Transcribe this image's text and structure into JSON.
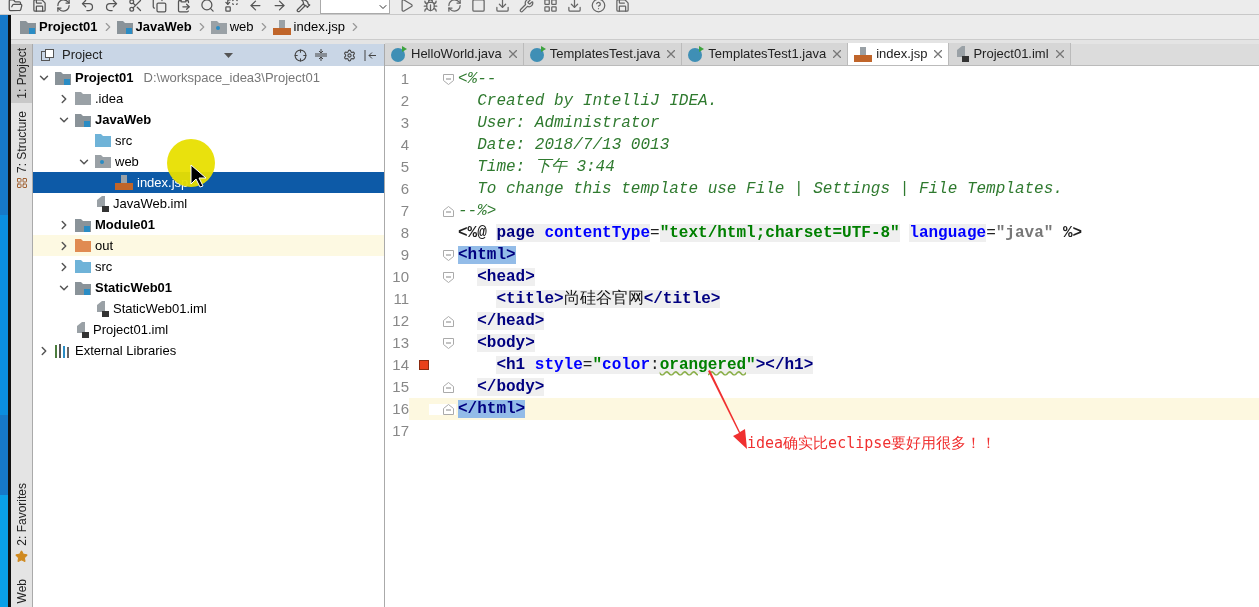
{
  "breadcrumb": [
    {
      "label": "Project01",
      "kind": "module"
    },
    {
      "label": "JavaWeb",
      "kind": "module"
    },
    {
      "label": "web",
      "kind": "web"
    },
    {
      "label": "index.jsp",
      "kind": "jsp"
    }
  ],
  "side_tabs": [
    {
      "label": "1: Project",
      "selected": true,
      "kind": "project"
    },
    {
      "label": "7: Structure",
      "selected": false,
      "kind": "structure"
    },
    {
      "label": "2: Favorites",
      "selected": false,
      "kind": "favorites"
    },
    {
      "label": "Web",
      "selected": false,
      "kind": "web"
    }
  ],
  "project_panel": {
    "title": "Project"
  },
  "tree": [
    {
      "label": "Project01",
      "path": "D:\\workspace_idea3\\Project01",
      "kind": "module",
      "expanded": true,
      "selected": false,
      "highlighted": false,
      "children": [
        {
          "label": ".idea",
          "kind": "folder",
          "expanded": false,
          "selected": false,
          "highlighted": false
        },
        {
          "label": "JavaWeb",
          "kind": "module",
          "expanded": true,
          "selected": false,
          "highlighted": false,
          "children": [
            {
              "label": "src",
              "kind": "source",
              "selected": false,
              "highlighted": false
            },
            {
              "label": "web",
              "kind": "web",
              "expanded": true,
              "selected": false,
              "highlighted": false,
              "children": [
                {
                  "label": "index.jsp",
                  "kind": "jsp",
                  "selected": true,
                  "highlighted": false
                }
              ]
            },
            {
              "label": "JavaWeb.iml",
              "kind": "iml",
              "selected": false,
              "highlighted": false
            }
          ]
        },
        {
          "label": "Module01",
          "kind": "module",
          "expanded": false,
          "selected": false,
          "highlighted": false
        },
        {
          "label": "out",
          "kind": "excluded",
          "expanded": false,
          "selected": false,
          "highlighted": true
        },
        {
          "label": "src",
          "kind": "source",
          "expanded": false,
          "selected": false,
          "highlighted": false
        },
        {
          "label": "StaticWeb01",
          "kind": "module",
          "expanded": true,
          "selected": false,
          "highlighted": false,
          "children": [
            {
              "label": "StaticWeb01.iml",
              "kind": "iml",
              "selected": false,
              "highlighted": false
            }
          ]
        },
        {
          "label": "Project01.iml",
          "kind": "iml",
          "selected": false,
          "highlighted": false
        }
      ]
    },
    {
      "label": "External Libraries",
      "kind": "libraries",
      "expanded": false,
      "selected": false,
      "highlighted": false
    }
  ],
  "editor_tabs": [
    {
      "label": "HelloWorld.java",
      "kind": "java",
      "selected": false
    },
    {
      "label": "TemplatesTest.java",
      "kind": "java",
      "selected": false
    },
    {
      "label": "TemplatesTest1.java",
      "kind": "java",
      "selected": false
    },
    {
      "label": "index.jsp",
      "kind": "jsp",
      "selected": true
    },
    {
      "label": "Project01.iml",
      "kind": "iml",
      "selected": false
    }
  ],
  "code_lines": [
    {
      "number": "1",
      "fold_open": true,
      "fold_close": false,
      "current": false,
      "marker": false,
      "tokens": [
        {
          "kind": "comment",
          "text": "<%--"
        }
      ]
    },
    {
      "number": "2",
      "fold_open": false,
      "fold_close": false,
      "current": false,
      "marker": false,
      "tokens": [
        {
          "kind": "comment",
          "text": "  Created by IntelliJ IDEA."
        }
      ]
    },
    {
      "number": "3",
      "fold_open": false,
      "fold_close": false,
      "current": false,
      "marker": false,
      "tokens": [
        {
          "kind": "comment",
          "text": "  User: Administrator"
        }
      ]
    },
    {
      "number": "4",
      "fold_open": false,
      "fold_close": false,
      "current": false,
      "marker": false,
      "tokens": [
        {
          "kind": "comment",
          "text": "  Date: 2018/7/13 0013"
        }
      ]
    },
    {
      "number": "5",
      "fold_open": false,
      "fold_close": false,
      "current": false,
      "marker": false,
      "tokens": [
        {
          "kind": "comment",
          "text": "  Time: 下午 3:44"
        }
      ]
    },
    {
      "number": "6",
      "fold_open": false,
      "fold_close": false,
      "current": false,
      "marker": false,
      "tokens": [
        {
          "kind": "comment",
          "text": "  To change this template use File | Settings | File Templates."
        }
      ]
    },
    {
      "number": "7",
      "fold_open": false,
      "fold_close": true,
      "current": false,
      "marker": false,
      "tokens": [
        {
          "kind": "comment",
          "text": "--%>"
        }
      ]
    },
    {
      "number": "8",
      "fold_open": false,
      "fold_close": false,
      "current": false,
      "marker": false,
      "tokens": [
        {
          "kind": "directive",
          "text": "<%@ "
        },
        {
          "kind": "tag",
          "text": "page "
        },
        {
          "kind": "attr",
          "text": "contentType"
        },
        {
          "kind": "plain",
          "text": "="
        },
        {
          "kind": "string",
          "text": "\"text/html;charset=UTF-8\""
        },
        {
          "kind": "attr",
          "text": " language"
        },
        {
          "kind": "plain",
          "text": "="
        },
        {
          "kind": "dim",
          "text": "\"java\""
        },
        {
          "kind": "directive",
          "text": " %>"
        }
      ]
    },
    {
      "number": "9",
      "fold_open": true,
      "fold_close": false,
      "current": false,
      "marker": false,
      "tokens": [
        {
          "kind": "match",
          "text": "<html>"
        }
      ]
    },
    {
      "number": "10",
      "fold_open": true,
      "fold_close": false,
      "current": false,
      "marker": false,
      "tokens": [
        {
          "kind": "tag",
          "text": "  <head>"
        }
      ]
    },
    {
      "number": "11",
      "fold_open": false,
      "fold_close": false,
      "current": false,
      "marker": false,
      "tokens": [
        {
          "kind": "tag",
          "text": "    <title>"
        },
        {
          "kind": "text",
          "text": "尚硅谷官网"
        },
        {
          "kind": "tag",
          "text": "</title>"
        }
      ]
    },
    {
      "number": "12",
      "fold_open": false,
      "fold_close": true,
      "current": false,
      "marker": false,
      "tokens": [
        {
          "kind": "tag",
          "text": "  </head>"
        }
      ]
    },
    {
      "number": "13",
      "fold_open": true,
      "fold_close": false,
      "current": false,
      "marker": false,
      "tokens": [
        {
          "kind": "tag",
          "text": "  <body>"
        }
      ]
    },
    {
      "number": "14",
      "fold_open": false,
      "fold_close": false,
      "current": false,
      "marker": true,
      "tokens": [
        {
          "kind": "tag",
          "text": "    <h1 "
        },
        {
          "kind": "attr",
          "text": "style"
        },
        {
          "kind": "tagplain",
          "text": "="
        },
        {
          "kind": "string",
          "text": "\""
        },
        {
          "kind": "attr",
          "text": "color"
        },
        {
          "kind": "tagplain",
          "text": ":"
        },
        {
          "kind": "warn",
          "text": "orangered"
        },
        {
          "kind": "string",
          "text": "\""
        },
        {
          "kind": "tag",
          "text": "></h1>"
        }
      ]
    },
    {
      "number": "15",
      "fold_open": false,
      "fold_close": true,
      "current": false,
      "marker": false,
      "tokens": [
        {
          "kind": "tag",
          "text": "  </body>"
        }
      ]
    },
    {
      "number": "16",
      "fold_open": false,
      "fold_close": true,
      "current": true,
      "marker": false,
      "tokens": [
        {
          "kind": "match",
          "text": "</html>"
        }
      ]
    },
    {
      "number": "17",
      "fold_open": false,
      "fold_close": false,
      "current": false,
      "marker": false
    }
  ],
  "annotation": {
    "text": "idea确实比eclipse要好用很多！！"
  }
}
